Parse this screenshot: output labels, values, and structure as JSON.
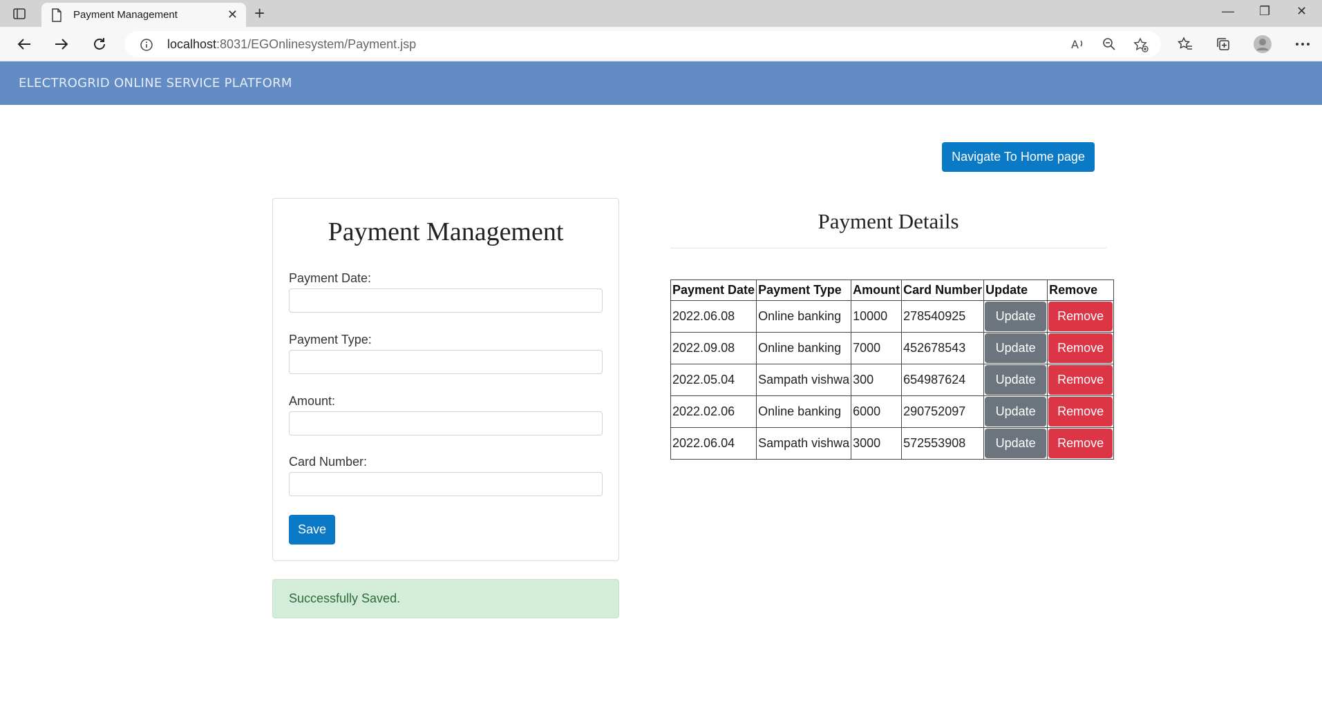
{
  "browser": {
    "tab_title": "Payment Management",
    "url_host": "localhost",
    "url_rest": ":8031/EGOnlinesystem/Payment.jsp"
  },
  "header": {
    "brand": "ELECTROGRID ONLINE SERVICE PLATFORM"
  },
  "home_button": "Navigate To Home page",
  "form": {
    "title": "Payment Management",
    "fields": [
      {
        "label": "Payment Date:",
        "value": ""
      },
      {
        "label": "Payment Type:",
        "value": ""
      },
      {
        "label": "Amount:",
        "value": ""
      },
      {
        "label": "Card Number:",
        "value": ""
      }
    ],
    "save_label": "Save"
  },
  "alert": "Successfully Saved.",
  "details": {
    "title": "Payment Details",
    "columns": [
      "Payment Date",
      "Payment Type",
      "Amount",
      "Card Number",
      "Update",
      "Remove"
    ],
    "rows": [
      {
        "date": "2022.06.08",
        "type": "Online banking",
        "amount": "10000",
        "card": "278540925",
        "update": "Update",
        "remove": "Remove"
      },
      {
        "date": "2022.09.08",
        "type": "Online banking",
        "amount": "7000",
        "card": "452678543",
        "update": "Update",
        "remove": "Remove"
      },
      {
        "date": "2022.05.04",
        "type": "Sampath vishwa",
        "amount": "300",
        "card": "654987624",
        "update": "Update",
        "remove": "Remove"
      },
      {
        "date": "2022.02.06",
        "type": "Online banking",
        "amount": "6000",
        "card": "290752097",
        "update": "Update",
        "remove": "Remove"
      },
      {
        "date": "2022.06.04",
        "type": "Sampath vishwa",
        "amount": "3000",
        "card": "572553908",
        "update": "Update",
        "remove": "Remove"
      }
    ]
  }
}
